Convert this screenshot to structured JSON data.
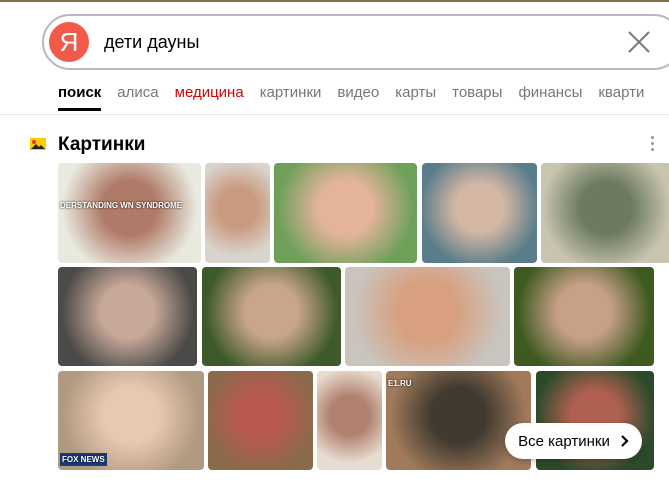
{
  "search": {
    "logo": "Я",
    "query": "дети дауны"
  },
  "tabs": [
    "поиск",
    "алиса",
    "медицина",
    "картинки",
    "видео",
    "карты",
    "товары",
    "финансы",
    "кварти"
  ],
  "section": {
    "title": "Картинки",
    "all_button": "Все картинки"
  },
  "images": [
    {
      "c1": "#e8eadf",
      "c2": "#b07a68",
      "caption": "DERSTANDING WN SYNDROME"
    },
    {
      "c1": "#d9d4cc",
      "c2": "#c99a80",
      "caption": ""
    },
    {
      "c1": "#6fa05a",
      "c2": "#e3b49a",
      "caption": ""
    },
    {
      "c1": "#5a7d8a",
      "c2": "#d5b7a5",
      "caption": ""
    },
    {
      "c1": "#c9c4b0",
      "c2": "#6b7a60",
      "caption": ""
    },
    {
      "c1": "#4a4a48",
      "c2": "#c8a898",
      "caption": ""
    },
    {
      "c1": "#3f5a2a",
      "c2": "#c9a58a",
      "caption": ""
    },
    {
      "c1": "#c9c4be",
      "c2": "#d8a080",
      "caption": ""
    },
    {
      "c1": "#3f5a20",
      "c2": "#c8a088",
      "caption": ""
    },
    {
      "c1": "#b09a80",
      "c2": "#e8c8b0",
      "caption": "FOX NEWS"
    },
    {
      "c1": "#8a6a4a",
      "c2": "#b85a50",
      "caption": ""
    },
    {
      "c1": "#e8dcd0",
      "c2": "#b08070",
      "caption": ""
    },
    {
      "c1": "#a07a5a",
      "c2": "#403a30",
      "caption": "E1.RU"
    },
    {
      "c1": "#2a4a2a",
      "c2": "#b06050",
      "caption": ""
    }
  ]
}
